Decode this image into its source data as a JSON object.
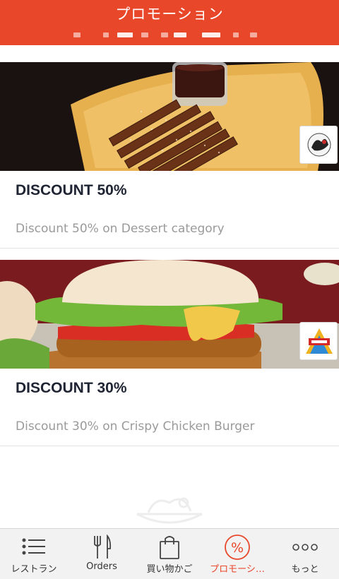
{
  "header": {
    "title": "プロモーション"
  },
  "promotions": [
    {
      "title": "DISCOUNT 50%",
      "description": "Discount 50% on Dessert category",
      "image_subject": "churros-with-chocolate-dip",
      "badge_icon": "restaurant-logo-badge"
    },
    {
      "title": "DISCOUNT 30%",
      "description": "Discount 30% on Crispy Chicken Burger",
      "image_subject": "crispy-chicken-burger",
      "badge_icon": "restaurant-logo-badge"
    }
  ],
  "empty_state_icon": "noodle-bowl-icon",
  "tabbar": {
    "active_index": 3,
    "items": [
      {
        "label": "レストラン",
        "icon": "list-icon"
      },
      {
        "label": "Orders",
        "icon": "fork-knife-icon"
      },
      {
        "label": "買い物かご",
        "icon": "shopping-bag-icon"
      },
      {
        "label": "プロモーシ…",
        "icon": "percent-icon"
      },
      {
        "label": "もっと",
        "icon": "more-dots-icon"
      }
    ]
  },
  "colors": {
    "accent": "#e8472a",
    "title_text": "#1f2433",
    "desc_text": "#9a9a9a"
  }
}
